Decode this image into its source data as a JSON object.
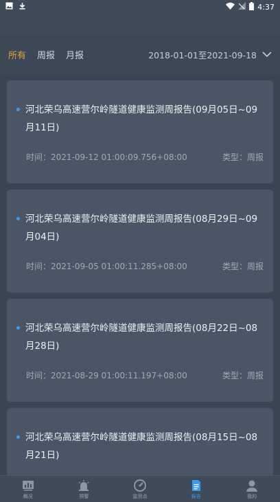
{
  "status_bar": {
    "time": "4:37"
  },
  "filter": {
    "tabs": [
      {
        "label": "所有",
        "active": true
      },
      {
        "label": "周报",
        "active": false
      },
      {
        "label": "月报",
        "active": false
      }
    ],
    "date_range": "2018-01-01至2021-09-18"
  },
  "reports": [
    {
      "title": "河北荣乌高速营尔岭隧道健康监测周报告(09月05日~09月11日)",
      "time": "时间：2021-09-12 01:00:09.756+08:00",
      "type": "类型：周报"
    },
    {
      "title": "河北荣乌高速营尔岭隧道健康监测周报告(08月29日~09月04日)",
      "time": "时间：2021-09-05 01:00:11.285+08:00",
      "type": "类型：周报"
    },
    {
      "title": "河北荣乌高速营尔岭隧道健康监测周报告(08月22日~08月28日)",
      "time": "时间：2021-08-29 01:00:11.197+08:00",
      "type": "类型：周报"
    },
    {
      "title": "河北荣乌高速营尔岭隧道健康监测周报告(08月15日~08月21日)",
      "time": "",
      "type": ""
    }
  ],
  "tabbar": [
    {
      "label": "概况",
      "icon": "overview-icon",
      "active": false
    },
    {
      "label": "预警",
      "icon": "alarm-icon",
      "active": false
    },
    {
      "label": "监测点",
      "icon": "gauge-icon",
      "active": false
    },
    {
      "label": "报告",
      "icon": "report-icon",
      "active": true
    },
    {
      "label": "我的",
      "icon": "user-icon",
      "active": false
    }
  ],
  "colors": {
    "accent": "#3b9bf0",
    "active_filter": "#e0a43a",
    "card_bg": "#4a5665",
    "page_bg": "#3a4553"
  }
}
